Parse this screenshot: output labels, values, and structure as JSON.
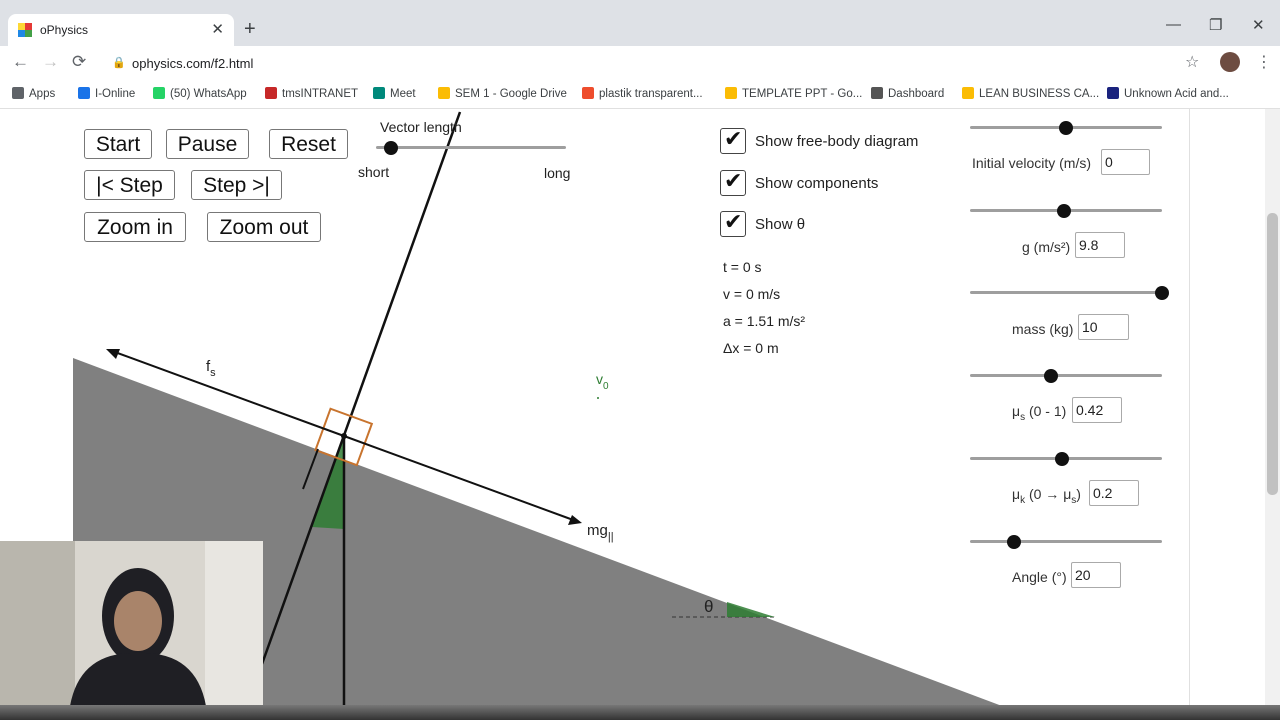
{
  "browser": {
    "tab_title": "oPhysics",
    "tab_close": "✕",
    "new_tab": "+",
    "url": "ophysics.com/f2.html",
    "window_controls": [
      "—",
      "❐",
      "✕"
    ],
    "bookmarks": [
      {
        "label": "Apps",
        "icon": "apps-grid-icon",
        "color": "#5f6368"
      },
      {
        "label": "I-Online",
        "icon": "i-online-icon",
        "color": "#1a73e8"
      },
      {
        "label": "(50) WhatsApp",
        "icon": "whatsapp-icon",
        "color": "#25d366"
      },
      {
        "label": "tmsINTRANET",
        "icon": "tms-icon",
        "color": "#c62828"
      },
      {
        "label": "Meet",
        "icon": "meet-icon",
        "color": "#00897b"
      },
      {
        "label": "SEM 1 - Google Drive",
        "icon": "drive-icon",
        "color": "#fbbc04"
      },
      {
        "label": "plastik transparent...",
        "icon": "shopee-icon",
        "color": "#ee4d2d"
      },
      {
        "label": "TEMPLATE PPT - Go...",
        "icon": "drive-icon",
        "color": "#fbbc04"
      },
      {
        "label": "Dashboard",
        "icon": "dashboard-icon",
        "color": "#555555"
      },
      {
        "label": "LEAN BUSINESS CA...",
        "icon": "drive-icon",
        "color": "#fbbc04"
      },
      {
        "label": "Unknown Acid and...",
        "icon": "flag-icon",
        "color": "#1a237e"
      }
    ]
  },
  "controls": {
    "start": "Start",
    "pause": "Pause",
    "reset": "Reset",
    "step_back": "|< Step",
    "step_forward": "Step >|",
    "zoom_in": "Zoom in",
    "zoom_out": "Zoom out"
  },
  "vector_length": {
    "label": "Vector length",
    "short": "short",
    "long": "long",
    "level": 0.08
  },
  "checkboxes": [
    {
      "label": "Show free-body diagram",
      "checked": true
    },
    {
      "label": "Show components",
      "checked": true
    },
    {
      "label": "Show θ",
      "checked": true
    }
  ],
  "readouts": {
    "t": "t = 0 s",
    "v": "v = 0 m/s",
    "a": "a = 1.51 m/s²",
    "dx": "Δx = 0 m"
  },
  "params": {
    "top_slider_level": 0.5,
    "initial_velocity": {
      "label": "Initial velocity (m/s)",
      "value": "0",
      "level": 0.49
    },
    "g": {
      "label": "g (m/s²)",
      "value": "9.8",
      "level": 1.0
    },
    "mass": {
      "label": "mass (kg)",
      "value": "10",
      "level": 0.42
    },
    "mu_s": {
      "label_main": "μ",
      "label_sub": "s",
      "label_tail": "(0 - 1)",
      "value": "0.42",
      "level": 0.48
    },
    "mu_k": {
      "label_main": "μ",
      "label_sub": "k",
      "label_tail_a": "(0 → μ",
      "label_tail_sub": "s",
      "label_tail_b": ")",
      "value": "0.2",
      "level": 0.23
    },
    "angle": {
      "label": "Angle (°)",
      "value": "20"
    }
  },
  "diagram": {
    "fs_main": "f",
    "fs_sub": "s",
    "mg_main": "mg",
    "mg_sub": "||",
    "v0_main": "v",
    "v0_sub": "0",
    "theta": "θ",
    "ramp_color": "#808080",
    "angle_color": "#2e7d32",
    "box_color": "#c8742e"
  }
}
